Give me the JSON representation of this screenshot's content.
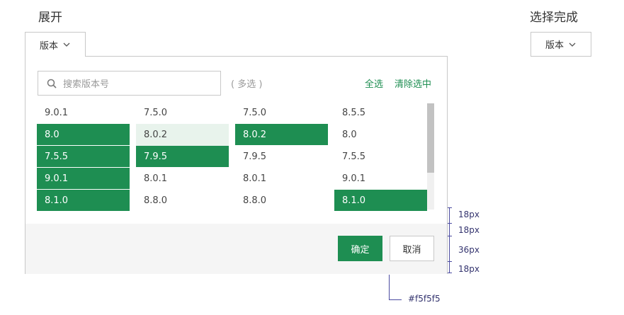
{
  "left": {
    "title": "展开",
    "dropdown_label": "版本"
  },
  "right": {
    "title": "选择完成",
    "dropdown_label": "版本"
  },
  "panel": {
    "search_placeholder": "搜索版本号",
    "multi_hint": "( 多选 )",
    "select_all": "全选",
    "clear_selection": "清除选中",
    "columns": [
      [
        {
          "label": "9.0.1",
          "state": "normal"
        },
        {
          "label": "8.0",
          "state": "selected"
        },
        {
          "label": "7.5.5",
          "state": "selected"
        },
        {
          "label": "9.0.1",
          "state": "selected"
        },
        {
          "label": "8.1.0",
          "state": "selected"
        }
      ],
      [
        {
          "label": "7.5.0",
          "state": "normal"
        },
        {
          "label": "8.0.2",
          "state": "hover"
        },
        {
          "label": "7.9.5",
          "state": "selected"
        },
        {
          "label": "8.0.1",
          "state": "normal"
        },
        {
          "label": "8.8.0",
          "state": "normal"
        }
      ],
      [
        {
          "label": "7.5.0",
          "state": "normal"
        },
        {
          "label": "8.0.2",
          "state": "selected"
        },
        {
          "label": "7.9.5",
          "state": "normal"
        },
        {
          "label": "8.0.1",
          "state": "normal"
        },
        {
          "label": "8.8.0",
          "state": "normal"
        }
      ],
      [
        {
          "label": "8.5.5",
          "state": "normal"
        },
        {
          "label": "8.0",
          "state": "normal"
        },
        {
          "label": "7.5.5",
          "state": "normal"
        },
        {
          "label": "9.0.1",
          "state": "normal"
        },
        {
          "label": "8.1.0",
          "state": "selected"
        }
      ]
    ],
    "confirm_label": "确定",
    "cancel_label": "取消"
  },
  "spec": {
    "padding_top_label": "18px",
    "gap_label": "18px",
    "button_height_label": "36px",
    "padding_bottom_label": "18px",
    "footer_color_label": "#f5f5f5"
  },
  "colors": {
    "accent": "#1e8e52",
    "hover": "#e8f3ec",
    "footer": "#f5f5f5"
  }
}
